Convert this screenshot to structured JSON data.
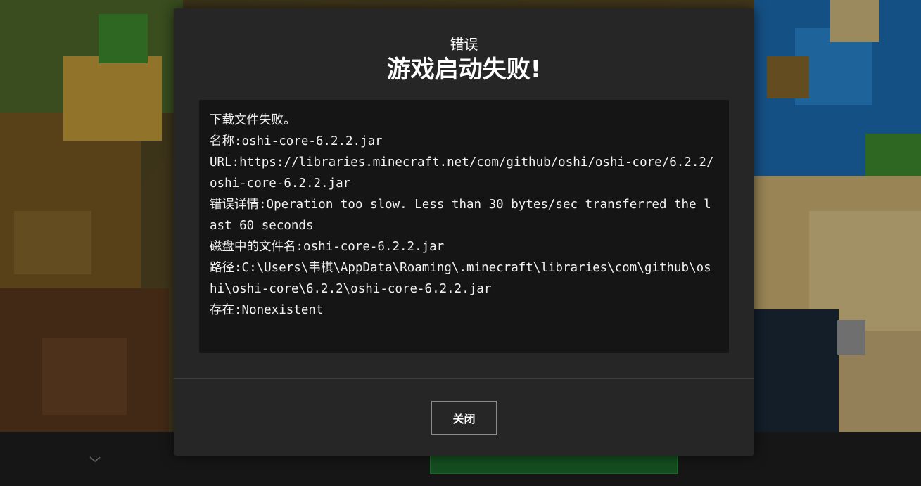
{
  "dialog": {
    "eyebrow": "错误",
    "title": "游戏启动失败!",
    "details": {
      "line1": "下载文件失败。",
      "line2": "名称:oshi-core-6.2.2.jar",
      "line3": "URL:https://libraries.minecraft.net/com/github/oshi/oshi-core/6.2.2/oshi-core-6.2.2.jar",
      "line4": "错误详情:Operation too slow. Less than 30 bytes/sec transferred the last 60 seconds",
      "line5": "磁盘中的文件名:oshi-core-6.2.2.jar",
      "line6": "路径:C:\\Users\\韦棋\\AppData\\Roaming\\.minecraft\\libraries\\com\\github\\oshi\\oshi-core\\6.2.2\\oshi-core-6.2.2.jar",
      "line7": "存在:Nonexistent"
    },
    "close_label": "关闭"
  },
  "icons": {
    "launcher_chevron": "chevron-down-icon"
  },
  "colors": {
    "dialog_bg": "#262626",
    "details_bg": "#151515",
    "text": "#ffffff",
    "play_button": "#1d6b2d"
  }
}
